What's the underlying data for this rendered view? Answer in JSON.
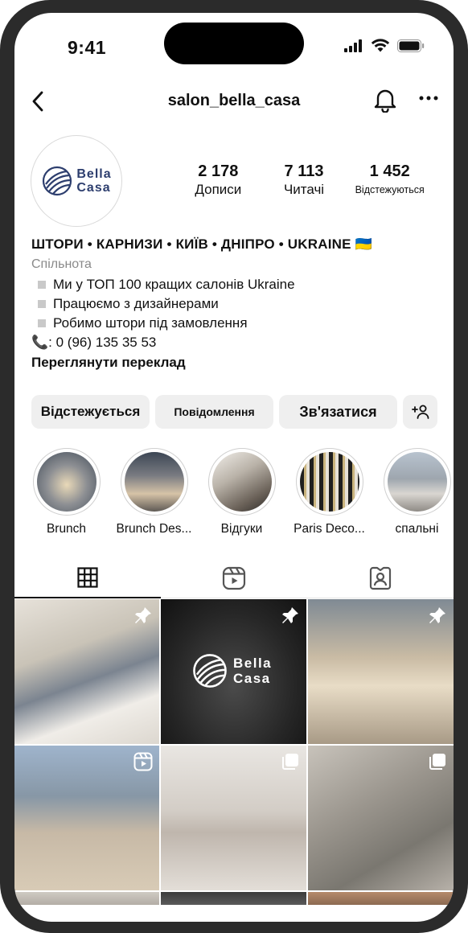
{
  "status_bar": {
    "time": "9:41"
  },
  "header": {
    "username": "salon_bella_casa"
  },
  "profile": {
    "logo_line1": "Bella",
    "logo_line2": "Casa",
    "stats": [
      {
        "value": "2 178",
        "label": "Дописи"
      },
      {
        "value": "7 113",
        "label": "Читачі"
      },
      {
        "value": "1 452",
        "label": "Відстежуються"
      }
    ],
    "bio": {
      "title": "ШТОРИ • КАРНИЗИ • КИЇВ • ДНІПРО • UKRAINE 🇺🇦",
      "category": "Спільнота",
      "lines": [
        "Ми у ТОП 100 кращих салонів Ukraine",
        "Працюємо з дизайнерами",
        "Робимо штори під замовлення"
      ],
      "phone": "📞: 0 (96) 135 35 53",
      "translate": "Переглянути переклад"
    }
  },
  "buttons": {
    "following": "Відстежується",
    "message": "Повідомлення",
    "contact": "Зв'язатися"
  },
  "highlights": [
    {
      "label": "Brunch"
    },
    {
      "label": "Brunch Des..."
    },
    {
      "label": "Відгуки"
    },
    {
      "label": "Paris Deco..."
    },
    {
      "label": "спальні"
    }
  ],
  "grid_logo": {
    "line1": "Bella",
    "line2": "Casa"
  },
  "colors": {
    "logo_blue": "#2d3e6e",
    "button_bg": "#efefef"
  }
}
